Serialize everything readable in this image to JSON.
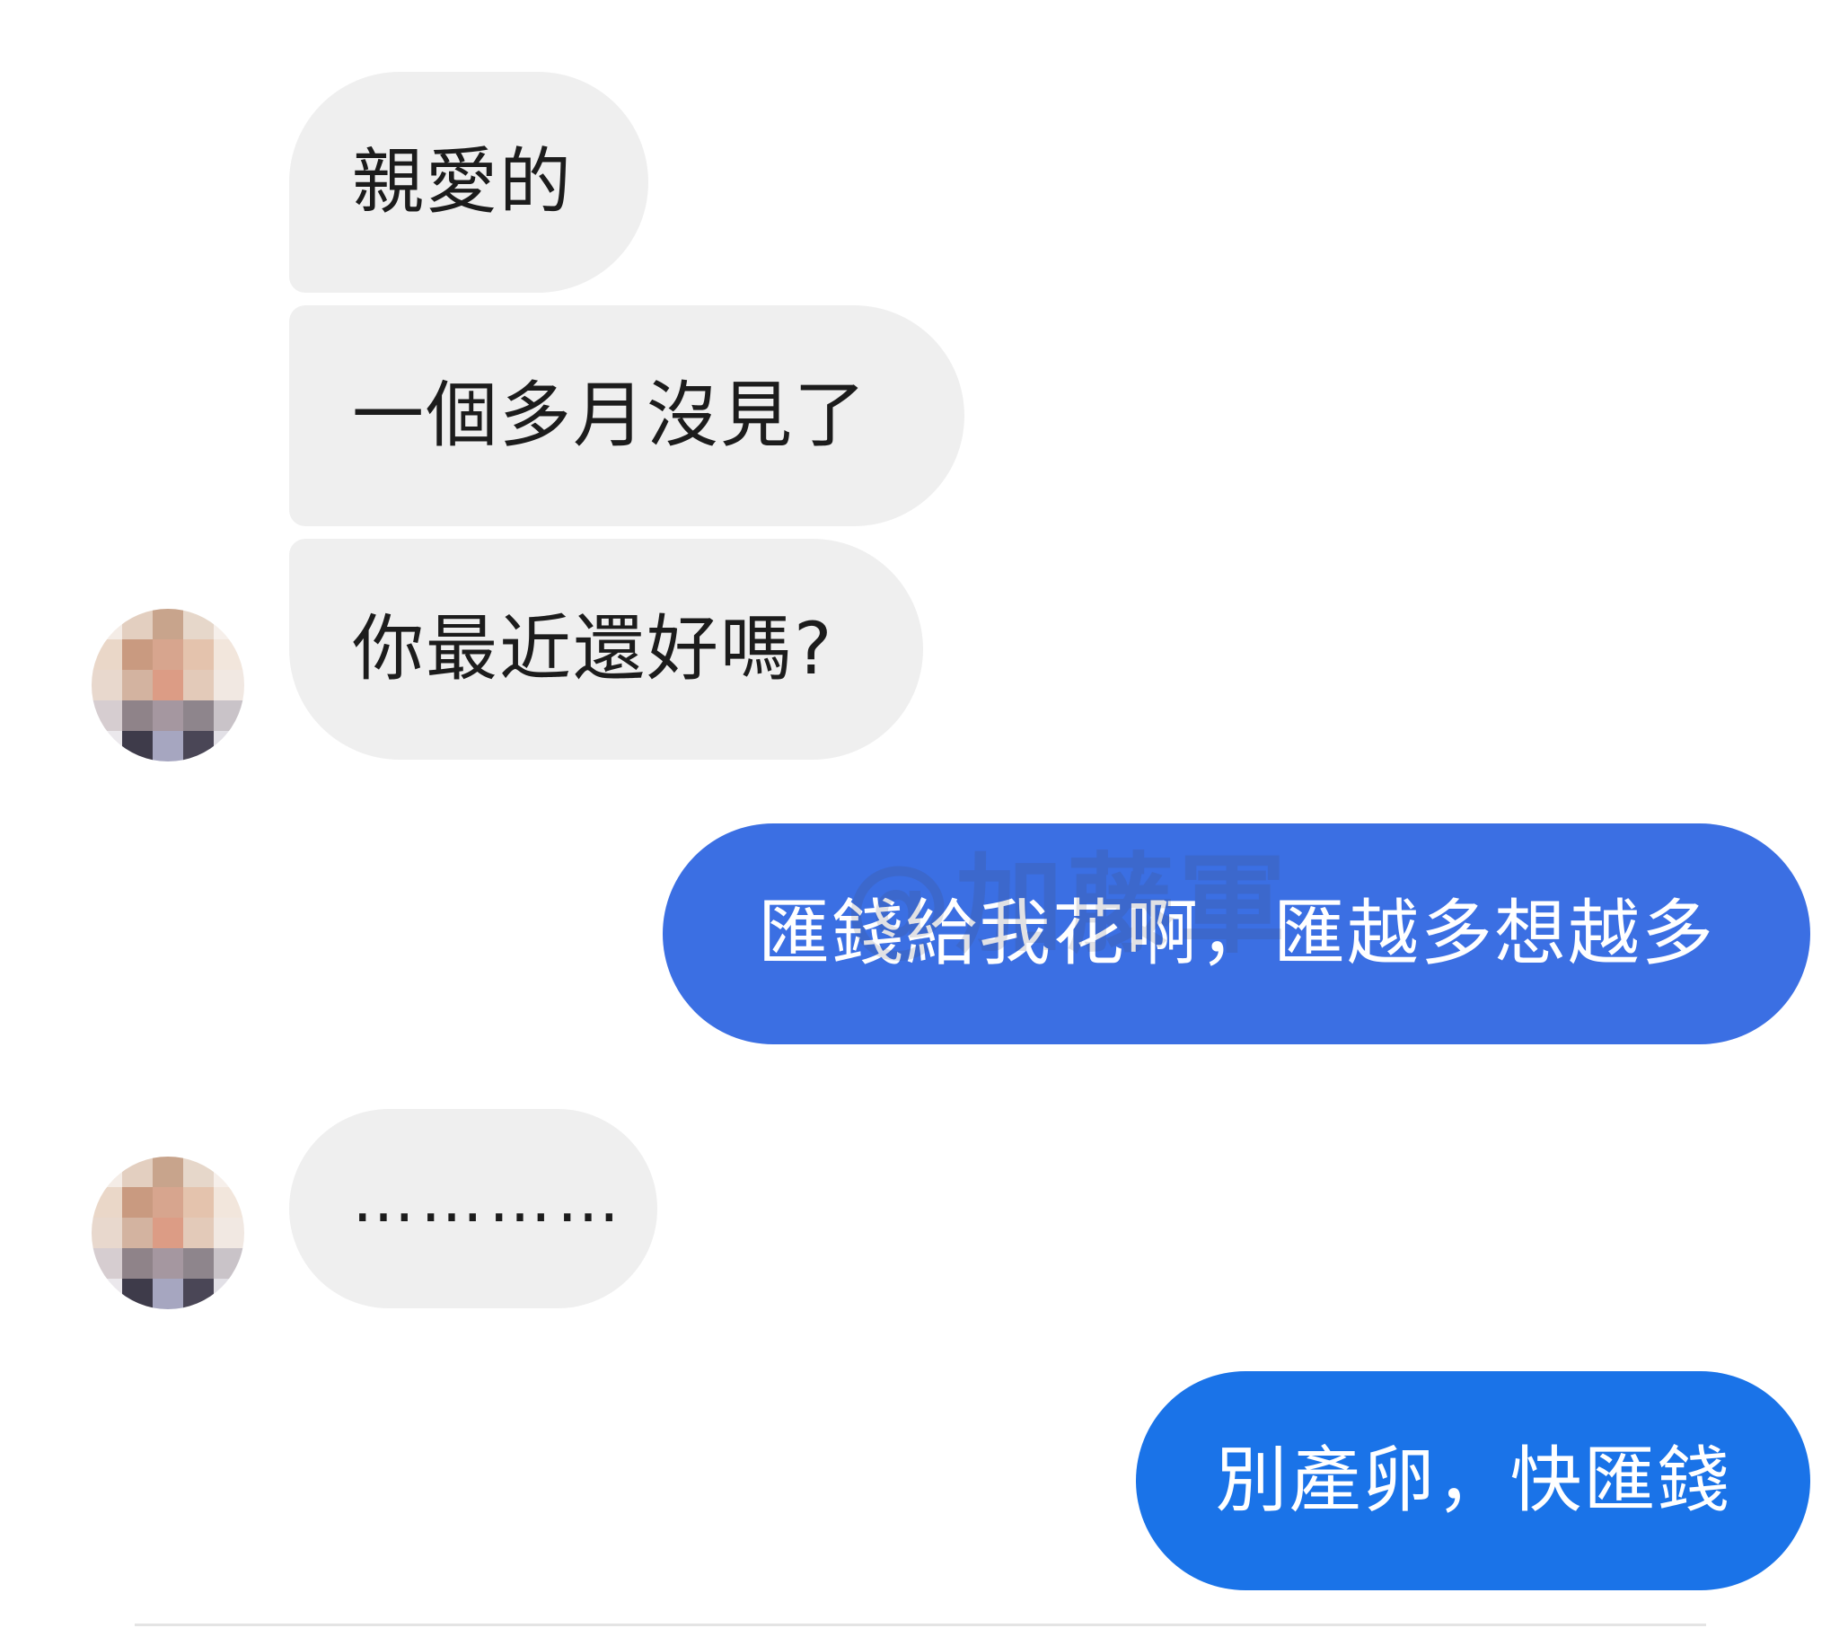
{
  "watermark": "@加藤軍",
  "messages": [
    {
      "side": "incoming",
      "text": "親愛的"
    },
    {
      "side": "incoming",
      "text": "一個多月沒見了"
    },
    {
      "side": "incoming",
      "text": "你最近還好嗎?"
    },
    {
      "side": "outgoing",
      "text": "匯錢給我花啊，匯越多想越多"
    },
    {
      "side": "incoming",
      "text": "…………"
    },
    {
      "side": "outgoing",
      "text": "別產卵，快匯錢"
    }
  ],
  "colors": {
    "incoming_bubble": "#efefef",
    "outgoing_bubble_1": "#3b6fe3",
    "outgoing_bubble_2": "#1a73e8",
    "background": "#ffffff"
  },
  "avatar": {
    "icon": "pixelated-avatar-icon",
    "pixels": [
      "#f4ece6",
      "#e3cfc0",
      "#c8a48c",
      "#e6d7ca",
      "#f6efea",
      "#ead7c8",
      "#c99a80",
      "#d7a58e",
      "#e4c3ad",
      "#f2e6dc",
      "#e8d8cd",
      "#d3b3a0",
      "#dc9c85",
      "#e3cab9",
      "#f1e8e2",
      "#d6cdd0",
      "#8f8389",
      "#a597a0",
      "#8e858c",
      "#c9c3c8",
      "#ebe8ec",
      "#3e3b4a",
      "#a6a6c0",
      "#4a4656",
      "#e2e0e6"
    ]
  }
}
